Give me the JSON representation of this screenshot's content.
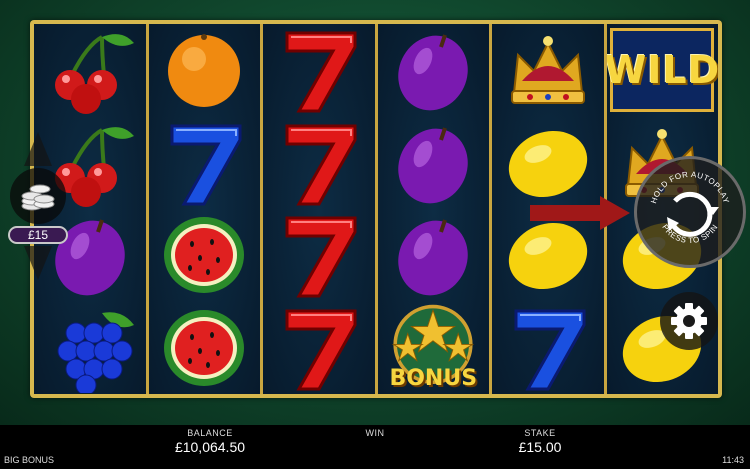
{
  "game": {
    "name": "BIG BONUS",
    "clock": "11:43"
  },
  "reels": [
    [
      "cherry",
      "cherry",
      "plum",
      "grapes"
    ],
    [
      "orange",
      "seven-blue",
      "watermelon",
      "watermelon"
    ],
    [
      "seven-red",
      "seven-red",
      "seven-red",
      "seven-red"
    ],
    [
      "plum",
      "plum",
      "plum",
      "bonus"
    ],
    [
      "crown",
      "lemon",
      "lemon",
      "seven-blue"
    ],
    [
      "wild",
      "crown",
      "lemon",
      "lemon"
    ]
  ],
  "symbols": {
    "wild_text": "WILD",
    "bonus_text": "BONUS"
  },
  "controls": {
    "stake_chip_label": "£15",
    "spin_hold_text": "HOLD FOR AUTOPLAY",
    "spin_press_text": "PRESS TO SPIN"
  },
  "info": {
    "balance_label": "BALANCE",
    "balance_value": "£10,064.50",
    "win_label": "WIN",
    "win_value": "",
    "stake_label": "STAKE",
    "stake_value": "£15.00"
  },
  "colors": {
    "frame_gold": "#d6b84e",
    "felt_green": "#114a2f",
    "reel_bg": "#071a2c"
  }
}
